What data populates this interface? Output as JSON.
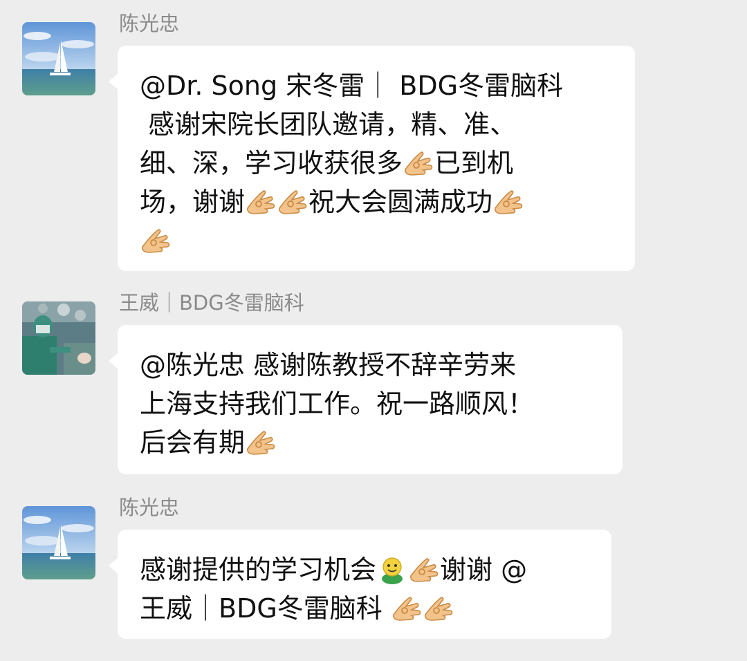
{
  "messages": [
    {
      "sender": "陈光忠",
      "avatar": "sailboat-avatar",
      "lines": [
        [
          "@Dr. Song 宋冬雷｜ BDG冬雷脑科"
        ],
        [
          " 感谢宋院长团队邀请，精、准、"
        ],
        [
          "细、深，学习收获很多",
          "{ok-hand-emoji}",
          "已到机"
        ],
        [
          "场，谢谢",
          "{ok-hand-emoji}",
          "{ok-hand-emoji}",
          "祝大会圆满成功",
          "{ok-hand-emoji}"
        ],
        [
          "{ok-hand-emoji}"
        ]
      ]
    },
    {
      "sender": "王威｜BDG冬雷脑科",
      "avatar": "surgeon-avatar",
      "lines": [
        [
          "@陈光忠 感谢陈教授不辞辛劳来"
        ],
        [
          "上海支持我们工作。祝一路顺风！"
        ],
        [
          "后会有期",
          "{ok-hand-emoji}"
        ]
      ]
    },
    {
      "sender": "陈光忠",
      "avatar": "sailboat-avatar",
      "lines": [
        [
          "感谢提供的学习机会",
          "{smile-emoji}",
          "{ok-hand-emoji}",
          "谢谢 @"
        ],
        [
          "王威｜BDG冬雷脑科 ",
          "{ok-hand-emoji}",
          "{ok-hand-emoji}"
        ]
      ]
    }
  ],
  "colors": {
    "background": "#ededed",
    "bubble": "#ffffff",
    "sender_name": "#8a8a8a"
  }
}
